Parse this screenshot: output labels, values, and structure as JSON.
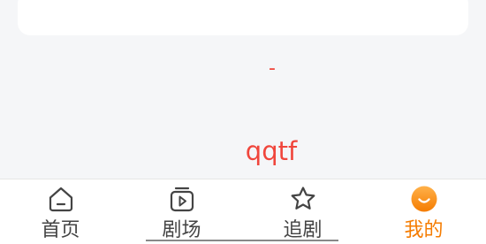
{
  "content": {
    "dash_text": "-",
    "center_text": "qqtf"
  },
  "colors": {
    "accent": "#f57c00",
    "text_red": "#f0463c",
    "tab_text": "#444444"
  },
  "tabbar": {
    "items": [
      {
        "label": "首页",
        "icon": "home-icon",
        "active": false
      },
      {
        "label": "剧场",
        "icon": "play-icon",
        "active": false
      },
      {
        "label": "追剧",
        "icon": "star-icon",
        "active": false
      },
      {
        "label": "我的",
        "icon": "smile-face-icon",
        "active": true
      }
    ]
  }
}
